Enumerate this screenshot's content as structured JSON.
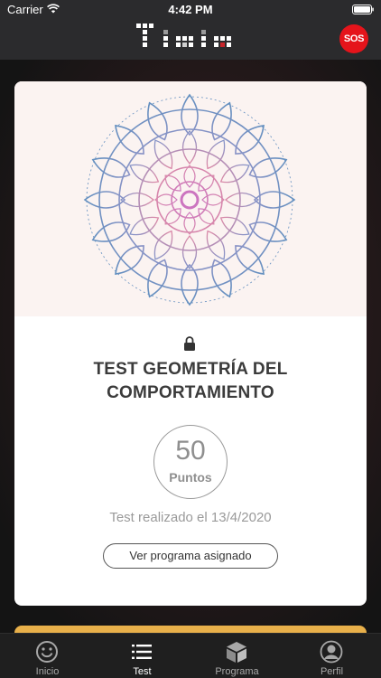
{
  "status_bar": {
    "carrier": "Carrier",
    "time": "4:42 PM"
  },
  "header": {
    "logo_icon": "timia-logo",
    "sos_label": "SOS"
  },
  "test_card": {
    "image_icon": "mandala",
    "lock_icon": "lock-icon",
    "title_line1": "TEST GEOMETRÍA DEL",
    "title_line2": "COMPORTAMIENTO",
    "score": "50",
    "score_unit": "Puntos",
    "date_text": "Test realizado el 13/4/2020",
    "program_button": "Ver programa asignado"
  },
  "tab_bar": {
    "tabs": [
      {
        "label": "Inicio",
        "icon": "smiley-icon"
      },
      {
        "label": "Test",
        "icon": "list-icon",
        "active": true
      },
      {
        "label": "Programa",
        "icon": "box-icon"
      },
      {
        "label": "Perfil",
        "icon": "user-icon"
      }
    ]
  },
  "colors": {
    "sos": "#e5141b",
    "accent_card": "#e8b04a",
    "bar": "#2b2b2d"
  }
}
